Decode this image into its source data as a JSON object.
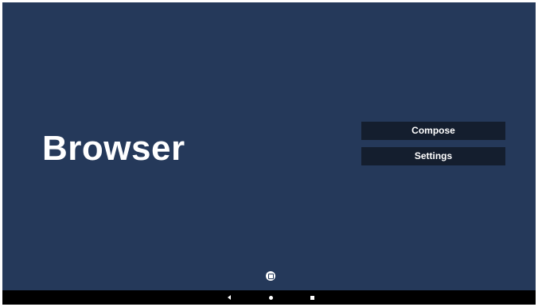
{
  "app": {
    "title": "Browser"
  },
  "menu": {
    "compose_label": "Compose",
    "settings_label": "Settings"
  },
  "floating_action": {
    "icon": "square-in-circle-icon"
  },
  "navigation_bar": {
    "back_icon": "back-triangle-icon",
    "home_icon": "home-dot-icon",
    "recents_icon": "recents-square-icon"
  },
  "colors": {
    "background": "#25395a",
    "button_background": "#141e2e",
    "text": "#ffffff",
    "nav_bar": "#000000"
  }
}
